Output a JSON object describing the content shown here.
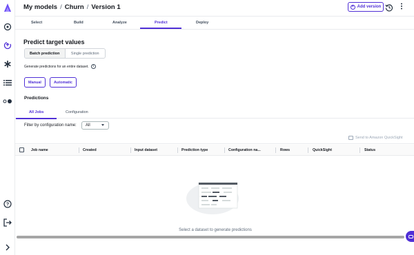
{
  "header": {
    "breadcrumb": [
      "My models",
      "Churn",
      "Version 1"
    ],
    "add_version_label": "Add version"
  },
  "tabs": [
    "Select",
    "Build",
    "Analyze",
    "Predict",
    "Deploy"
  ],
  "active_tab": "Predict",
  "predict": {
    "title": "Predict target values",
    "segments": [
      "Batch prediction",
      "Single prediction"
    ],
    "selected_segment": "Batch prediction",
    "description": "Generate predictions for an entire dataset.",
    "mode_buttons": [
      "Manual",
      "Automatic"
    ]
  },
  "predictions": {
    "title": "Predictions",
    "subtabs": [
      "All Jobs",
      "Configuration"
    ],
    "active_subtab": "All Jobs",
    "filter_label": "Filter by configuration name:",
    "filter_value": "All",
    "send_quicksight_label": "Send to Amazon QuickSight",
    "columns": [
      "Job name",
      "Created",
      "Input dataset",
      "Prediction type",
      "Configuration na...",
      "Rows",
      "QuickSight",
      "Status"
    ],
    "empty_message": "Select a dataset to generate predictions"
  },
  "rail_icons": [
    "canvas-logo-icon",
    "globe-icon",
    "models-icon",
    "asterisk-icon",
    "list-icon",
    "toggle-icon",
    "help-icon",
    "logout-icon",
    "expand-icon"
  ],
  "colors": {
    "accent": "#4f2fd6",
    "text": "#16191f",
    "muted": "#5f6b7a",
    "border": "#e9ebed"
  }
}
